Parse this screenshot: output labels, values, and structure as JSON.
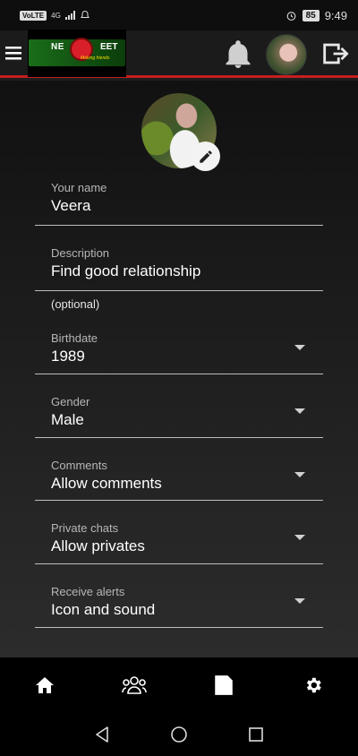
{
  "status_bar": {
    "network_badge": "VoLTE",
    "network_type": "4G",
    "battery": "85",
    "time": "9:49"
  },
  "app_bar": {
    "logo_text_left": "NE",
    "logo_text_right": "EET",
    "logo_tagline": "Making friends",
    "accent_color": "#c41f1f"
  },
  "form": {
    "name": {
      "label": "Your name",
      "value": "Veera"
    },
    "description": {
      "label": "Description",
      "value": "Find good relationship",
      "hint": "(optional)"
    },
    "birthdate": {
      "label": "Birthdate",
      "value": "1989"
    },
    "gender": {
      "label": "Gender",
      "value": "Male"
    },
    "comments": {
      "label": "Comments",
      "value": "Allow comments"
    },
    "private_chats": {
      "label": "Private chats",
      "value": "Allow privates"
    },
    "receive_alerts": {
      "label": "Receive alerts",
      "value": "Icon and sound"
    }
  },
  "bottom_nav": {
    "items": [
      "home-icon",
      "people-icon",
      "page-icon",
      "settings-icon"
    ]
  },
  "system_nav": {
    "items": [
      "back-icon",
      "home-circle-icon",
      "recents-icon"
    ]
  }
}
